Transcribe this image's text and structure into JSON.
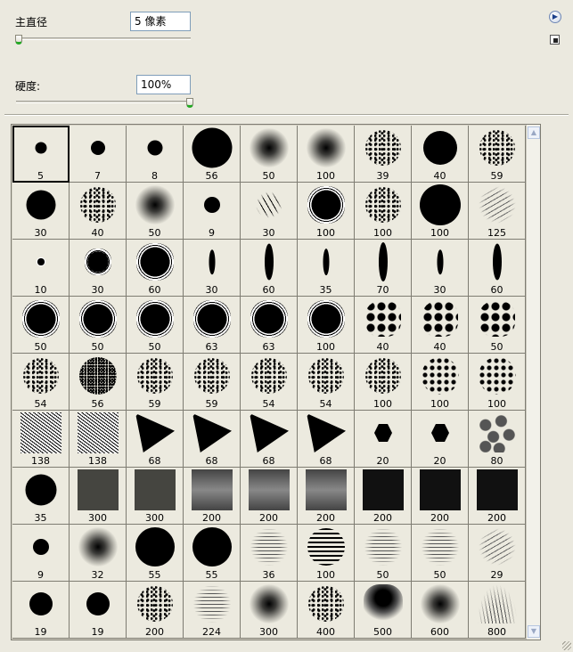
{
  "diameter": {
    "label": "主直径",
    "value": "5 像素",
    "slider_value": 0.0
  },
  "hardness": {
    "label": "硬度:",
    "value": "100%",
    "slider_value": 1.0
  },
  "menu_button_icon": "triangle-right-icon",
  "preset_button_icon": "new-preset-icon",
  "accent_colors": {
    "thumb_indicator": "#25a825",
    "field_border": "#7f9db9",
    "panel_bg": "#ebe9df"
  },
  "brushes": [
    {
      "size": "5",
      "kind": "dot",
      "selected": true
    },
    {
      "size": "7",
      "kind": "dot"
    },
    {
      "size": "8",
      "kind": "dot"
    },
    {
      "size": "56",
      "kind": "dot"
    },
    {
      "size": "50",
      "kind": "soft"
    },
    {
      "size": "100",
      "kind": "soft"
    },
    {
      "size": "39",
      "kind": "spatter"
    },
    {
      "size": "40",
      "kind": "dot"
    },
    {
      "size": "59",
      "kind": "spatter"
    },
    {
      "size": "30",
      "kind": "dot"
    },
    {
      "size": "40",
      "kind": "spatter"
    },
    {
      "size": "50",
      "kind": "soft"
    },
    {
      "size": "9",
      "kind": "dot"
    },
    {
      "size": "30",
      "kind": "shards"
    },
    {
      "size": "100",
      "kind": "rough"
    },
    {
      "size": "100",
      "kind": "spatter"
    },
    {
      "size": "100",
      "kind": "dot"
    },
    {
      "size": "125",
      "kind": "scribble"
    },
    {
      "size": "10",
      "kind": "rough"
    },
    {
      "size": "30",
      "kind": "rough"
    },
    {
      "size": "60",
      "kind": "rough"
    },
    {
      "size": "30",
      "kind": "ellipse"
    },
    {
      "size": "60",
      "kind": "ellipse"
    },
    {
      "size": "35",
      "kind": "ellipse"
    },
    {
      "size": "70",
      "kind": "ellipse"
    },
    {
      "size": "30",
      "kind": "ellipse"
    },
    {
      "size": "60",
      "kind": "ellipse"
    },
    {
      "size": "50",
      "kind": "rough"
    },
    {
      "size": "50",
      "kind": "rough"
    },
    {
      "size": "50",
      "kind": "rough"
    },
    {
      "size": "63",
      "kind": "rough"
    },
    {
      "size": "63",
      "kind": "rough"
    },
    {
      "size": "100",
      "kind": "rough"
    },
    {
      "size": "40",
      "kind": "dots"
    },
    {
      "size": "40",
      "kind": "dots"
    },
    {
      "size": "50",
      "kind": "dots"
    },
    {
      "size": "54",
      "kind": "spatter"
    },
    {
      "size": "56",
      "kind": "spatter-heavy"
    },
    {
      "size": "59",
      "kind": "spatter"
    },
    {
      "size": "59",
      "kind": "spatter"
    },
    {
      "size": "54",
      "kind": "spatter"
    },
    {
      "size": "54",
      "kind": "spatter"
    },
    {
      "size": "100",
      "kind": "spatter"
    },
    {
      "size": "100",
      "kind": "dots-small"
    },
    {
      "size": "100",
      "kind": "dots-small"
    },
    {
      "size": "138",
      "kind": "texture"
    },
    {
      "size": "138",
      "kind": "texture"
    },
    {
      "size": "68",
      "kind": "tri"
    },
    {
      "size": "68",
      "kind": "tri"
    },
    {
      "size": "68",
      "kind": "tri"
    },
    {
      "size": "68",
      "kind": "tri"
    },
    {
      "size": "20",
      "kind": "hex"
    },
    {
      "size": "20",
      "kind": "hex"
    },
    {
      "size": "80",
      "kind": "hexes"
    },
    {
      "size": "35",
      "kind": "dot"
    },
    {
      "size": "300",
      "kind": "sq-flat"
    },
    {
      "size": "300",
      "kind": "sq-flat"
    },
    {
      "size": "200",
      "kind": "sq-grad"
    },
    {
      "size": "200",
      "kind": "sq-grad"
    },
    {
      "size": "200",
      "kind": "sq-grad"
    },
    {
      "size": "200",
      "kind": "sq-black"
    },
    {
      "size": "200",
      "kind": "sq-black"
    },
    {
      "size": "200",
      "kind": "sq-black"
    },
    {
      "size": "9",
      "kind": "dot"
    },
    {
      "size": "32",
      "kind": "soft"
    },
    {
      "size": "55",
      "kind": "dot"
    },
    {
      "size": "55",
      "kind": "dot"
    },
    {
      "size": "36",
      "kind": "lines-soft"
    },
    {
      "size": "100",
      "kind": "lines"
    },
    {
      "size": "50",
      "kind": "lines-soft"
    },
    {
      "size": "50",
      "kind": "lines-soft"
    },
    {
      "size": "29",
      "kind": "scribble"
    },
    {
      "size": "19",
      "kind": "dot"
    },
    {
      "size": "19",
      "kind": "dot"
    },
    {
      "size": "200",
      "kind": "spatter"
    },
    {
      "size": "224",
      "kind": "lines-soft"
    },
    {
      "size": "300",
      "kind": "soft"
    },
    {
      "size": "400",
      "kind": "spatter"
    },
    {
      "size": "500",
      "kind": "cloud"
    },
    {
      "size": "600",
      "kind": "soft"
    },
    {
      "size": "800",
      "kind": "grass"
    }
  ]
}
